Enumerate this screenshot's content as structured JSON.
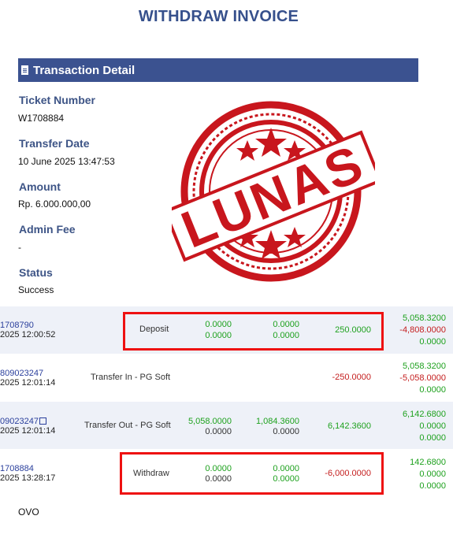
{
  "header": {
    "title": "WITHDRAW INVOICE"
  },
  "section": {
    "title": "Transaction Detail",
    "icon": "document-icon"
  },
  "fields": {
    "ticket_label": "Ticket Number",
    "ticket_value": "W1708884",
    "date_label": "Transfer Date",
    "date_value": "10 June 2025 13:47:53",
    "amount_label": "Amount",
    "amount_value": "Rp. 6.000.000,00",
    "fee_label": "Admin Fee",
    "fee_value": "-",
    "status_label": "Status",
    "status_value": "Success"
  },
  "stamp": {
    "text": "LUNAS",
    "color": "#c8161d"
  },
  "rows": [
    {
      "id": "1708790",
      "date": "2025 12:00:52",
      "type": "Deposit",
      "c1": [
        "0.0000",
        "0.0000"
      ],
      "c2": [
        "0.0000",
        "0.0000"
      ],
      "c3": "250.0000",
      "bal": [
        "5,058.3200",
        "-4,808.0000",
        "0.0000"
      ]
    },
    {
      "id": "809023247",
      "date": "2025 12:01:14",
      "type": "Transfer In - PG Soft",
      "c1": [
        "",
        ""
      ],
      "c2": [
        "",
        ""
      ],
      "c3": "-250.0000",
      "bal": [
        "5,058.3200",
        "-5,058.0000",
        "0.0000"
      ]
    },
    {
      "id": "09023247",
      "date": "2025 12:01:14",
      "type": "Transfer Out - PG Soft",
      "c1": [
        "5,058.0000",
        "0.0000"
      ],
      "c2": [
        "1,084.3600",
        "0.0000"
      ],
      "c3": "6,142.3600",
      "bal": [
        "6,142.6800",
        "0.0000",
        "0.0000"
      ]
    },
    {
      "id": "1708884",
      "date": "2025 13:28:17",
      "type": "Withdraw",
      "c1": [
        "0.0000",
        "0.0000"
      ],
      "c2": [
        "0.0000",
        "0.0000"
      ],
      "c3": "-6,000.0000",
      "bal": [
        "142.6800",
        "0.0000",
        "0.0000"
      ]
    }
  ],
  "footer": {
    "method": "OVO"
  }
}
